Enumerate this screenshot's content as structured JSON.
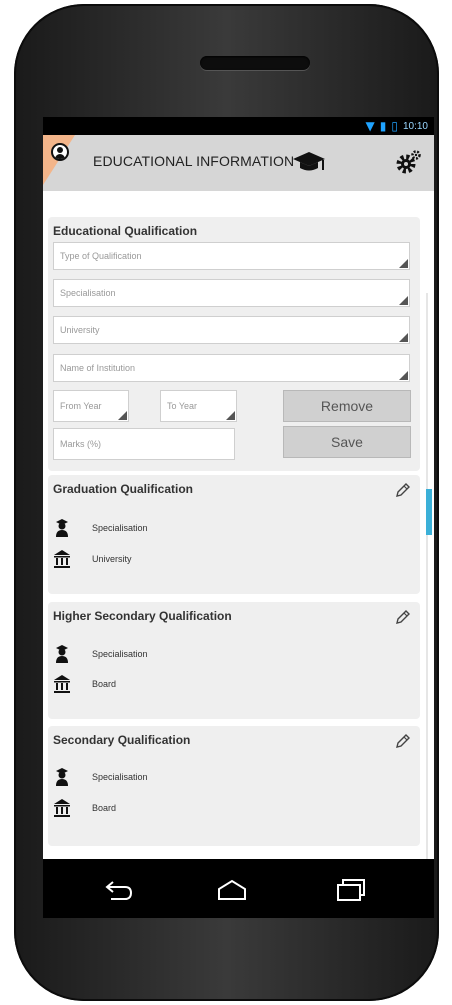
{
  "status": {
    "time": "10:10"
  },
  "app": {
    "title": "EDUCATIONAL INFORMATION"
  },
  "form": {
    "title": "Educational Qualification",
    "fields": {
      "type_of_qualification": "Type of Qualification",
      "specialisation": "Specialisation",
      "university": "University",
      "institution": "Name of Institution",
      "from_year": "From Year",
      "to_year": "To Year",
      "marks": "Marks (%)"
    },
    "buttons": {
      "remove": "Remove",
      "save": "Save"
    }
  },
  "cards": [
    {
      "title": "Graduation Qualification",
      "row1": "Specialisation",
      "row2": "University"
    },
    {
      "title": "Higher Secondary Qualification",
      "row1": "Specialisation",
      "row2": "Board"
    },
    {
      "title": "Secondary Qualification",
      "row1": "Specialisation",
      "row2": "Board"
    }
  ],
  "icons": {
    "avatar": "user-avatar-icon",
    "cap": "graduation-cap-icon",
    "settings": "gear-icon",
    "edit": "pencil-icon",
    "student": "student-icon",
    "institution": "building-icon",
    "back": "back-icon",
    "home": "home-icon",
    "recent": "recent-apps-icon"
  },
  "colors": {
    "accent": "#f3b58a",
    "scroll": "#3bb0d8",
    "appbar": "#d6d6d6",
    "status": "#1fa3ff"
  }
}
